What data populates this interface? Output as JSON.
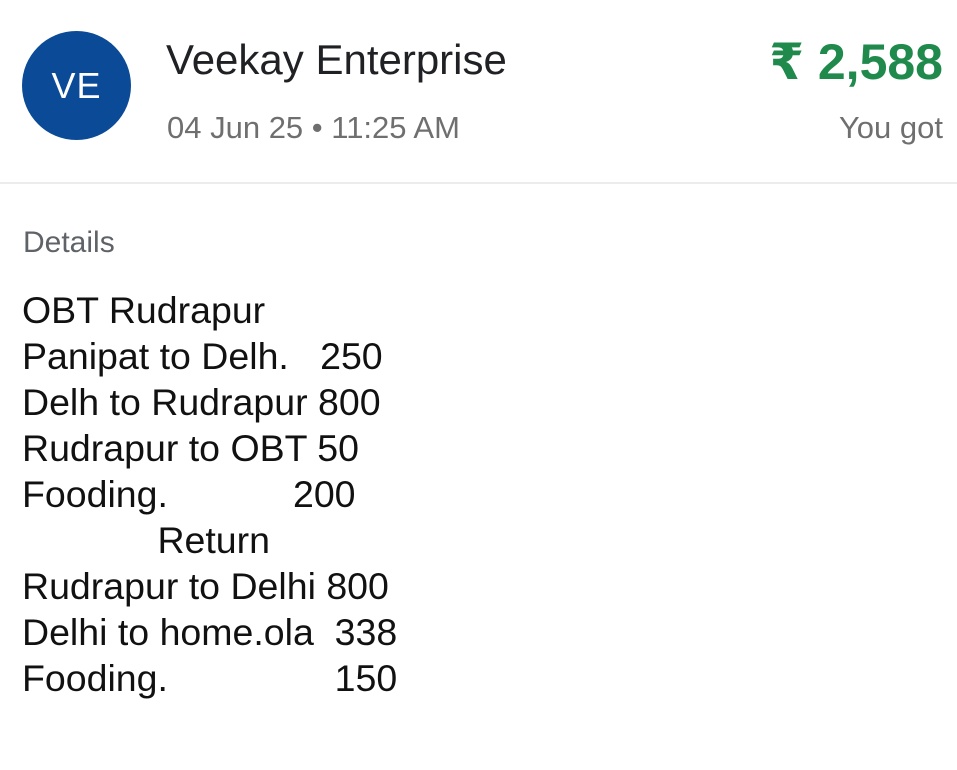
{
  "transaction": {
    "avatar_initials": "VE",
    "avatar_color": "#0a4a96",
    "counterparty_name": "Veekay Enterprise",
    "timestamp": "04 Jun 25 • 11:25 AM",
    "amount": "₹ 2,588",
    "amount_color": "#1f8a4c",
    "direction": "You got"
  },
  "details": {
    "heading": "Details",
    "note_lines": [
      "OBT Rudrapur",
      "Panipat to Delh.   250",
      "Delh to Rudrapur 800",
      "Rudrapur to OBT 50",
      "Fooding.            200",
      "             Return",
      "Rudrapur to Delhi 800",
      "Delhi to home.ola  338",
      "Fooding.                150"
    ]
  }
}
